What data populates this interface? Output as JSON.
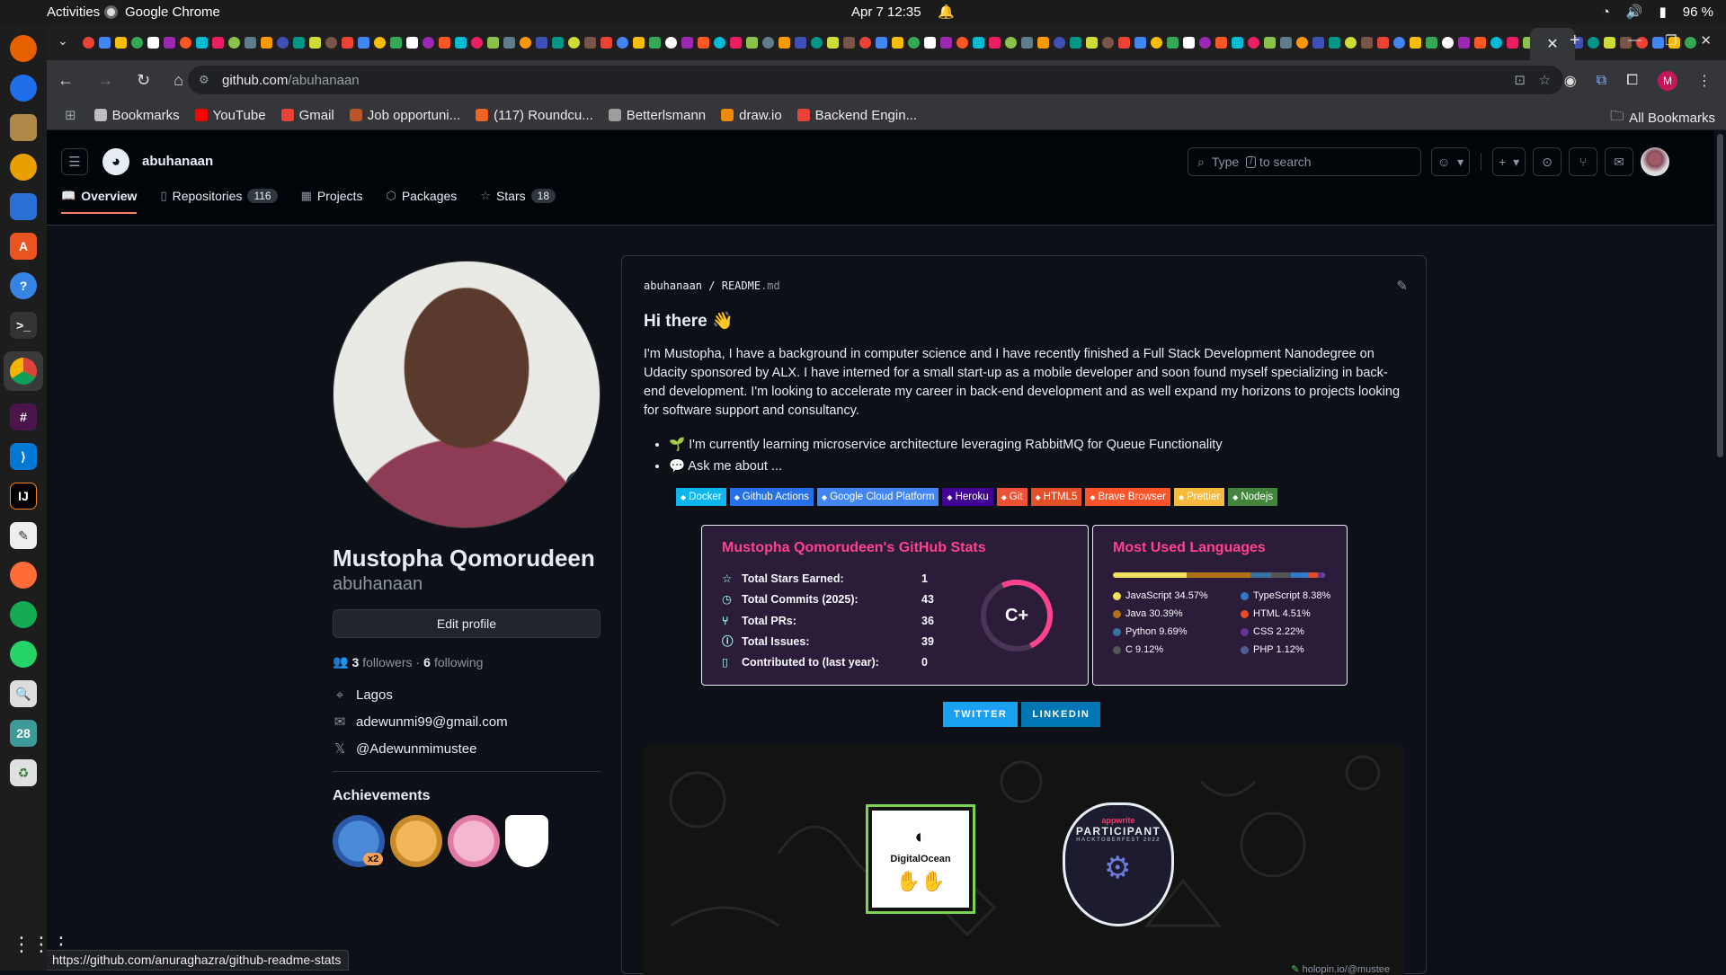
{
  "os": {
    "activities": "Activities",
    "app_name": "Google Chrome",
    "clock": "Apr 7  12:35",
    "battery": "96 %"
  },
  "browser": {
    "url_host": "github.com",
    "url_path": "/abuhanaan",
    "bookmarks": [
      {
        "label": "Bookmarks",
        "color": "#bdbdbd"
      },
      {
        "label": "YouTube",
        "color": "#ff0000"
      },
      {
        "label": "Gmail",
        "color": "#ea4335"
      },
      {
        "label": "Job opportuni...",
        "color": "#b8562a"
      },
      {
        "label": "(117) Roundcu...",
        "color": "#f26522"
      },
      {
        "label": "Betterlsmann",
        "color": "#9e9e9e"
      },
      {
        "label": "draw.io",
        "color": "#f08705"
      },
      {
        "label": "Backend Engin...",
        "color": "#ea4335"
      }
    ],
    "all_bookmarks": "All Bookmarks",
    "avatar_letter": "M",
    "status_url": "https://github.com/anuraghazra/github-readme-stats"
  },
  "github": {
    "username": "abuhanaan",
    "search_placeholder_pre": "Type",
    "search_slash": "/",
    "search_placeholder_post": "to search",
    "tabs": [
      {
        "label": "Overview",
        "count": null
      },
      {
        "label": "Repositories",
        "count": "116"
      },
      {
        "label": "Projects",
        "count": null
      },
      {
        "label": "Packages",
        "count": null
      },
      {
        "label": "Stars",
        "count": "18"
      }
    ]
  },
  "profile": {
    "full_name": "Mustopha Qomorudeen",
    "login": "abuhanaan",
    "edit_label": "Edit profile",
    "followers": "3",
    "followers_label": "followers",
    "following": "6",
    "following_label": "following",
    "location": "Lagos",
    "email": "adewunmi99@gmail.com",
    "twitter": "@Adewunmimustee",
    "achievements_title": "Achievements",
    "achievement_multiplier": "x2"
  },
  "readme": {
    "owner": "abuhanaan",
    "file": "README",
    "ext": ".md",
    "heading": "Hi there 👋",
    "intro": "I'm Mustopha, I have a background in computer science and I have recently finished a Full Stack Development Nanodegree on Udacity sponsored by ALX. I have interned for a small start-up as a mobile developer and soon found myself specializing in back-end development. I'm looking to accelerate my career in back-end development and as well expand my horizons to projects looking for software support and consultancy.",
    "bullets": [
      "🌱 I'm currently learning microservice architecture leveraging RabbitMQ for Queue Functionality",
      "💬 Ask me about ..."
    ],
    "shields": [
      {
        "label": "Docker",
        "color": "#0db7ed"
      },
      {
        "label": "Github Actions",
        "color": "#2671e5"
      },
      {
        "label": "Google Cloud Platform",
        "color": "#4285f4"
      },
      {
        "label": "Heroku",
        "color": "#430098"
      },
      {
        "label": "Git",
        "color": "#f05033"
      },
      {
        "label": "HTML5",
        "color": "#e34f26"
      },
      {
        "label": "Brave Browser",
        "color": "#fb542b"
      },
      {
        "label": "Prettier",
        "color": "#f7b93e"
      },
      {
        "label": "Nodejs",
        "color": "#43853d"
      }
    ],
    "stats": {
      "title": "Mustopha Qomorudeen's GitHub Stats",
      "rows": [
        {
          "label": "Total Stars Earned:",
          "value": "1"
        },
        {
          "label": "Total Commits (2025):",
          "value": "43"
        },
        {
          "label": "Total PRs:",
          "value": "36"
        },
        {
          "label": "Total Issues:",
          "value": "39"
        },
        {
          "label": "Contributed to (last year):",
          "value": "0"
        }
      ],
      "rank": "C+"
    },
    "langs": {
      "title": "Most Used Languages",
      "items": [
        {
          "label": "JavaScript 34.57%",
          "pct": 34.57,
          "color": "#f1e05a"
        },
        {
          "label": "TypeScript 8.38%",
          "pct": 8.38,
          "color": "#3178c6"
        },
        {
          "label": "Java 30.39%",
          "pct": 30.39,
          "color": "#b07219"
        },
        {
          "label": "HTML 4.51%",
          "pct": 4.51,
          "color": "#e34c26"
        },
        {
          "label": "Python 9.69%",
          "pct": 9.69,
          "color": "#3572a5"
        },
        {
          "label": "CSS 2.22%",
          "pct": 2.22,
          "color": "#663399"
        },
        {
          "label": "C 9.12%",
          "pct": 9.12,
          "color": "#555555"
        },
        {
          "label": "PHP 1.12%",
          "pct": 1.12,
          "color": "#4f5d95"
        }
      ]
    },
    "social": [
      "TWITTER",
      "LINKEDIN"
    ],
    "badge_do": "DigitalOcean",
    "badge_aw_top": "appwrite",
    "badge_aw_main": "PARTICIPANT",
    "badge_aw_sub": "HACKTOBERFEST 2022",
    "holopin": "holopin.io/@mustee"
  }
}
